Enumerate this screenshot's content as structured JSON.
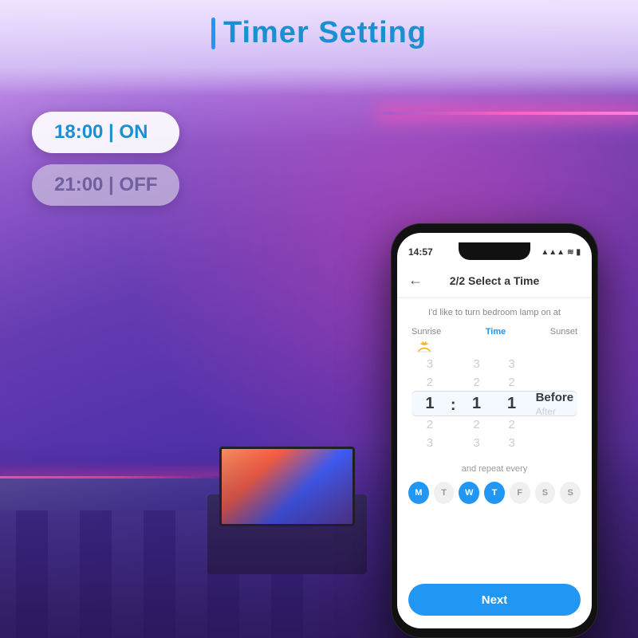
{
  "page": {
    "title": "Timer Setting",
    "title_bar_color": "#2196F3",
    "title_color": "#1a8fd1"
  },
  "timers": [
    {
      "label": "18:00 | ON",
      "type": "on"
    },
    {
      "label": "21:00 | OFF",
      "type": "off"
    }
  ],
  "phone": {
    "status_time": "14:57",
    "status_signal": "▲",
    "header_title": "2/2 Select a Time",
    "back_arrow": "←",
    "subtitle": "I'd like to turn bedroom lamp on at",
    "picker": {
      "sunrise_label": "Sunrise",
      "time_label": "Time",
      "sunset_label": "Sunset",
      "columns": [
        {
          "above": "3",
          "above2": "2",
          "selected": "1",
          "below": "2",
          "below2": "3"
        },
        {
          "above": "3",
          "above2": "2",
          "selected": "1",
          "below": "2",
          "below2": "3"
        },
        {
          "above": "3",
          "above2": "2",
          "selected": "1",
          "below": "2",
          "below2": "3"
        }
      ],
      "before_label": "Before",
      "after_label": "After"
    },
    "repeat_label": "and repeat every",
    "days": [
      {
        "label": "M",
        "active": true
      },
      {
        "label": "T",
        "active": false
      },
      {
        "label": "W",
        "active": true
      },
      {
        "label": "T",
        "active": true
      },
      {
        "label": "F",
        "active": false
      },
      {
        "label": "S",
        "active": false
      },
      {
        "label": "S",
        "active": false
      }
    ],
    "next_button": "Next"
  }
}
